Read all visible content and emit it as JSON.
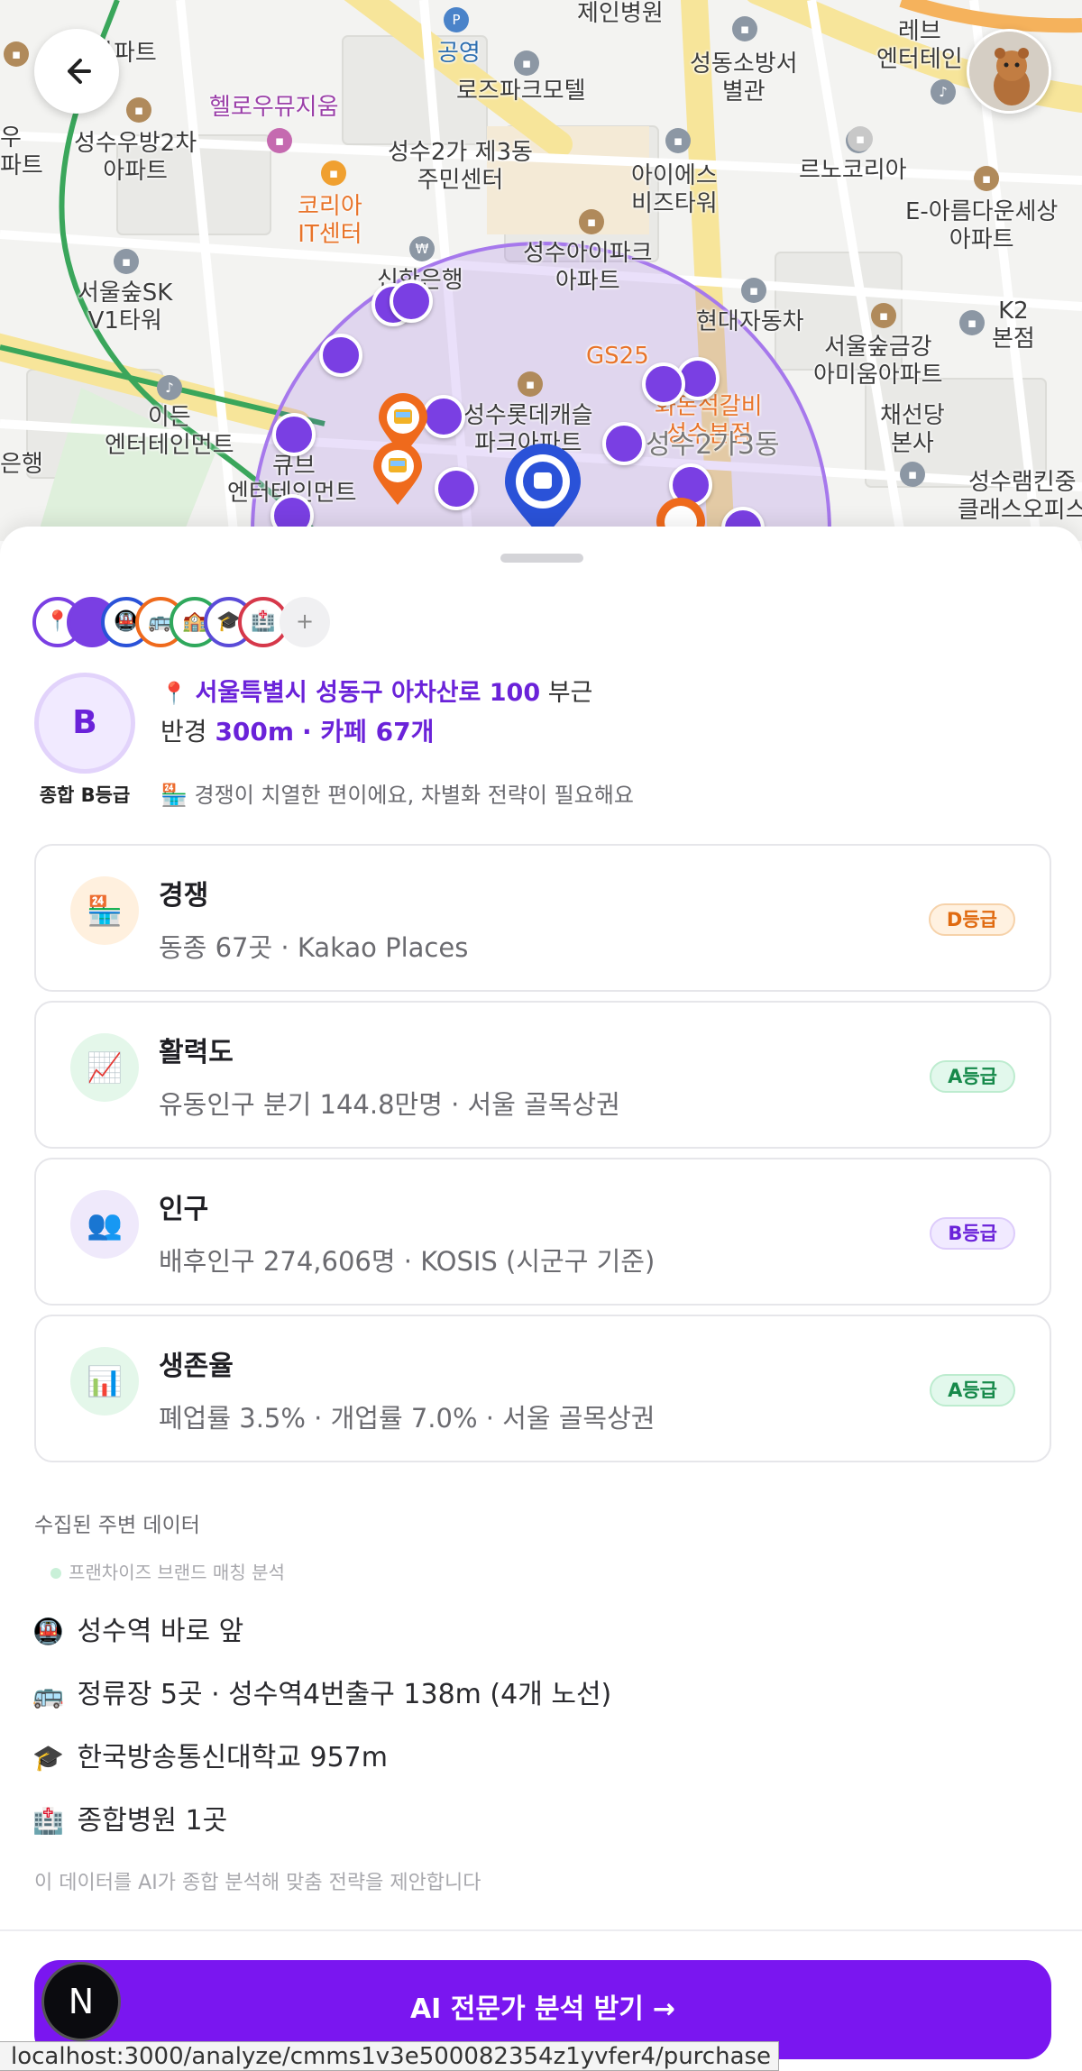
{
  "map": {
    "labels": {
      "hospital": "제인병원",
      "park": "공영",
      "rose_motel": "로즈파크모텔",
      "annex": "성동소방서\n별관",
      "lev": "레브\n엔터테인",
      "museum": "헬로우뮤지움",
      "woobang": "성수우방2차\n아파트",
      "community": "성수2가 제3동\n주민센터",
      "ies": "아이에스\n비즈타워",
      "renokorea": "르노코리아",
      "ehome": "E-아름다운세상\n아파트",
      "korea_it": "코리아\nIT센터",
      "sk": "서울숲SK\nV1타워",
      "shinhan": "신한은행",
      "ipark": "성수아이파크\n아파트",
      "hyundai": "현대자동차",
      "k2": "K2\n본점",
      "gs25": "GS25",
      "seoulsup": "서울숲금강\n아미움아파트",
      "chaesun": "채선당\n본사",
      "eden": "이든\n엔터테인먼트",
      "bank": "은행",
      "lotte": "성수롯데캐슬\n파크아파트",
      "galbi": "화돈석갈비\n성수본점",
      "seongsu23": "성수2가3동",
      "entertain": "엔터테인먼트",
      "cube": "큐브",
      "ramkin": "성수램킨중\n클래스오피스",
      "apt_top": "아파트",
      "woo": "우\n파트"
    }
  },
  "header": {
    "back_icon": "back-arrow-icon",
    "avatar_icon": "user-avatar-icon"
  },
  "summary": {
    "grade_letter": "B",
    "grade_caption": "종합 B등급",
    "address": "서울특별시 성동구 아차산로 100",
    "address_suffix": "부근",
    "radius_prefix": "반경",
    "radius_value": "300m",
    "cafe_count": "카페 67개",
    "tip_text": "경쟁이 치열한 편이에요, 차별화 전략이 필요해요",
    "stack_more": "+"
  },
  "cards": [
    {
      "title": "경쟁",
      "sub": "동종 67곳 · Kakao Places",
      "badge": "D등급",
      "icon": "convenience-store-icon",
      "emoji": "🏪",
      "badge_bg": "#fff1e0",
      "badge_fg": "#e06a10",
      "badge_border": "#f6d2aa",
      "icon_bg": "#fff0de"
    },
    {
      "title": "활력도",
      "sub": "유동인구 분기 144.8만명 · 서울 골목상권",
      "badge": "A등급",
      "icon": "trend-chart-icon",
      "emoji": "📈",
      "badge_bg": "#e2f8ec",
      "badge_fg": "#16894a",
      "badge_border": "#bdeccf",
      "icon_bg": "#e4f7ea"
    },
    {
      "title": "인구",
      "sub": "배후인구 274,606명 · KOSIS (시군구 기준)",
      "badge": "B등급",
      "icon": "people-icon",
      "emoji": "👥",
      "badge_bg": "#f1eaff",
      "badge_fg": "#6a22d9",
      "badge_border": "#ddccfb",
      "icon_bg": "#efe9fb"
    },
    {
      "title": "생존율",
      "sub": "폐업률 3.5% · 개업률 7.0% · 서울 골목상권",
      "badge": "A등급",
      "icon": "bar-chart-icon",
      "emoji": "📊",
      "badge_bg": "#e2f8ec",
      "badge_fg": "#16894a",
      "badge_border": "#bdeccf",
      "icon_bg": "#e4f7ea"
    }
  ],
  "collected": {
    "title": "수집된 주변 데이터",
    "subtitle": "프랜차이즈 브랜드 매칭 분석",
    "items": [
      {
        "emoji": "🚇",
        "icon": "subway-icon",
        "text": "성수역 바로 앞"
      },
      {
        "emoji": "🚌",
        "icon": "bus-icon",
        "text": "정류장 5곳 · 성수역4번출구 138m (4개 노선)"
      },
      {
        "emoji": "🎓",
        "icon": "graduation-cap-icon",
        "text": "한국방송통신대학교 957m"
      },
      {
        "emoji": "🏥",
        "icon": "hospital-icon",
        "text": "종합병원 1곳"
      }
    ],
    "note": "이 데이터를 AI가 종합 분석해 맞춤 전략을 제안합니다"
  },
  "cta": {
    "label": "AI 전문가 분석 받기",
    "arrow": "→",
    "logo": "N"
  },
  "status_bar": {
    "url": "localhost:3000/analyze/cmms1v3e500082354z1yvfer4/purchase"
  },
  "colors": {
    "accent": "#7a16f0",
    "grade_purple": "#6a22d9"
  }
}
